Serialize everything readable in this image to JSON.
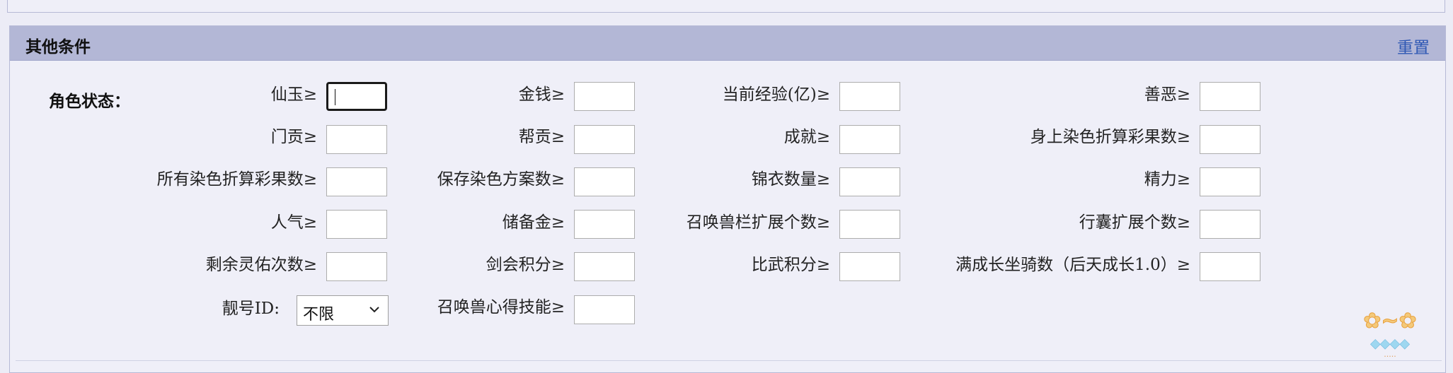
{
  "panel": {
    "title": "其他条件",
    "reset": "重置",
    "section_label": "角色状态："
  },
  "fields": [
    {
      "label": "仙玉≥",
      "value": ""
    },
    {
      "label": "金钱≥",
      "value": ""
    },
    {
      "label": "当前经验(亿)≥",
      "value": ""
    },
    {
      "label": "善恶≥",
      "value": ""
    },
    {
      "label": "门贡≥",
      "value": ""
    },
    {
      "label": "帮贡≥",
      "value": ""
    },
    {
      "label": "成就≥",
      "value": ""
    },
    {
      "label": "身上染色折算彩果数≥",
      "value": ""
    },
    {
      "label": "所有染色折算彩果数≥",
      "value": ""
    },
    {
      "label": "保存染色方案数≥",
      "value": ""
    },
    {
      "label": "锦衣数量≥",
      "value": ""
    },
    {
      "label": "精力≥",
      "value": ""
    },
    {
      "label": "人气≥",
      "value": ""
    },
    {
      "label": "储备金≥",
      "value": ""
    },
    {
      "label": "召唤兽栏扩展个数≥",
      "value": ""
    },
    {
      "label": "行囊扩展个数≥",
      "value": ""
    },
    {
      "label": "剩余灵佑次数≥",
      "value": ""
    },
    {
      "label": "剑会积分≥",
      "value": ""
    },
    {
      "label": "比武积分≥",
      "value": ""
    },
    {
      "label": "满成长坐骑数（后天成长1.0）≥",
      "value": ""
    },
    {
      "label": "召唤兽心得技能≥",
      "value": ""
    }
  ],
  "pretty_id": {
    "label": "靓号ID:",
    "selected": "不限"
  },
  "colors": {
    "header": "#b3b7d6",
    "link": "#2f58b4",
    "background": "#ececf6"
  },
  "icons": {
    "dropdown": "chevron-down-icon",
    "watermark": "game-logo"
  }
}
